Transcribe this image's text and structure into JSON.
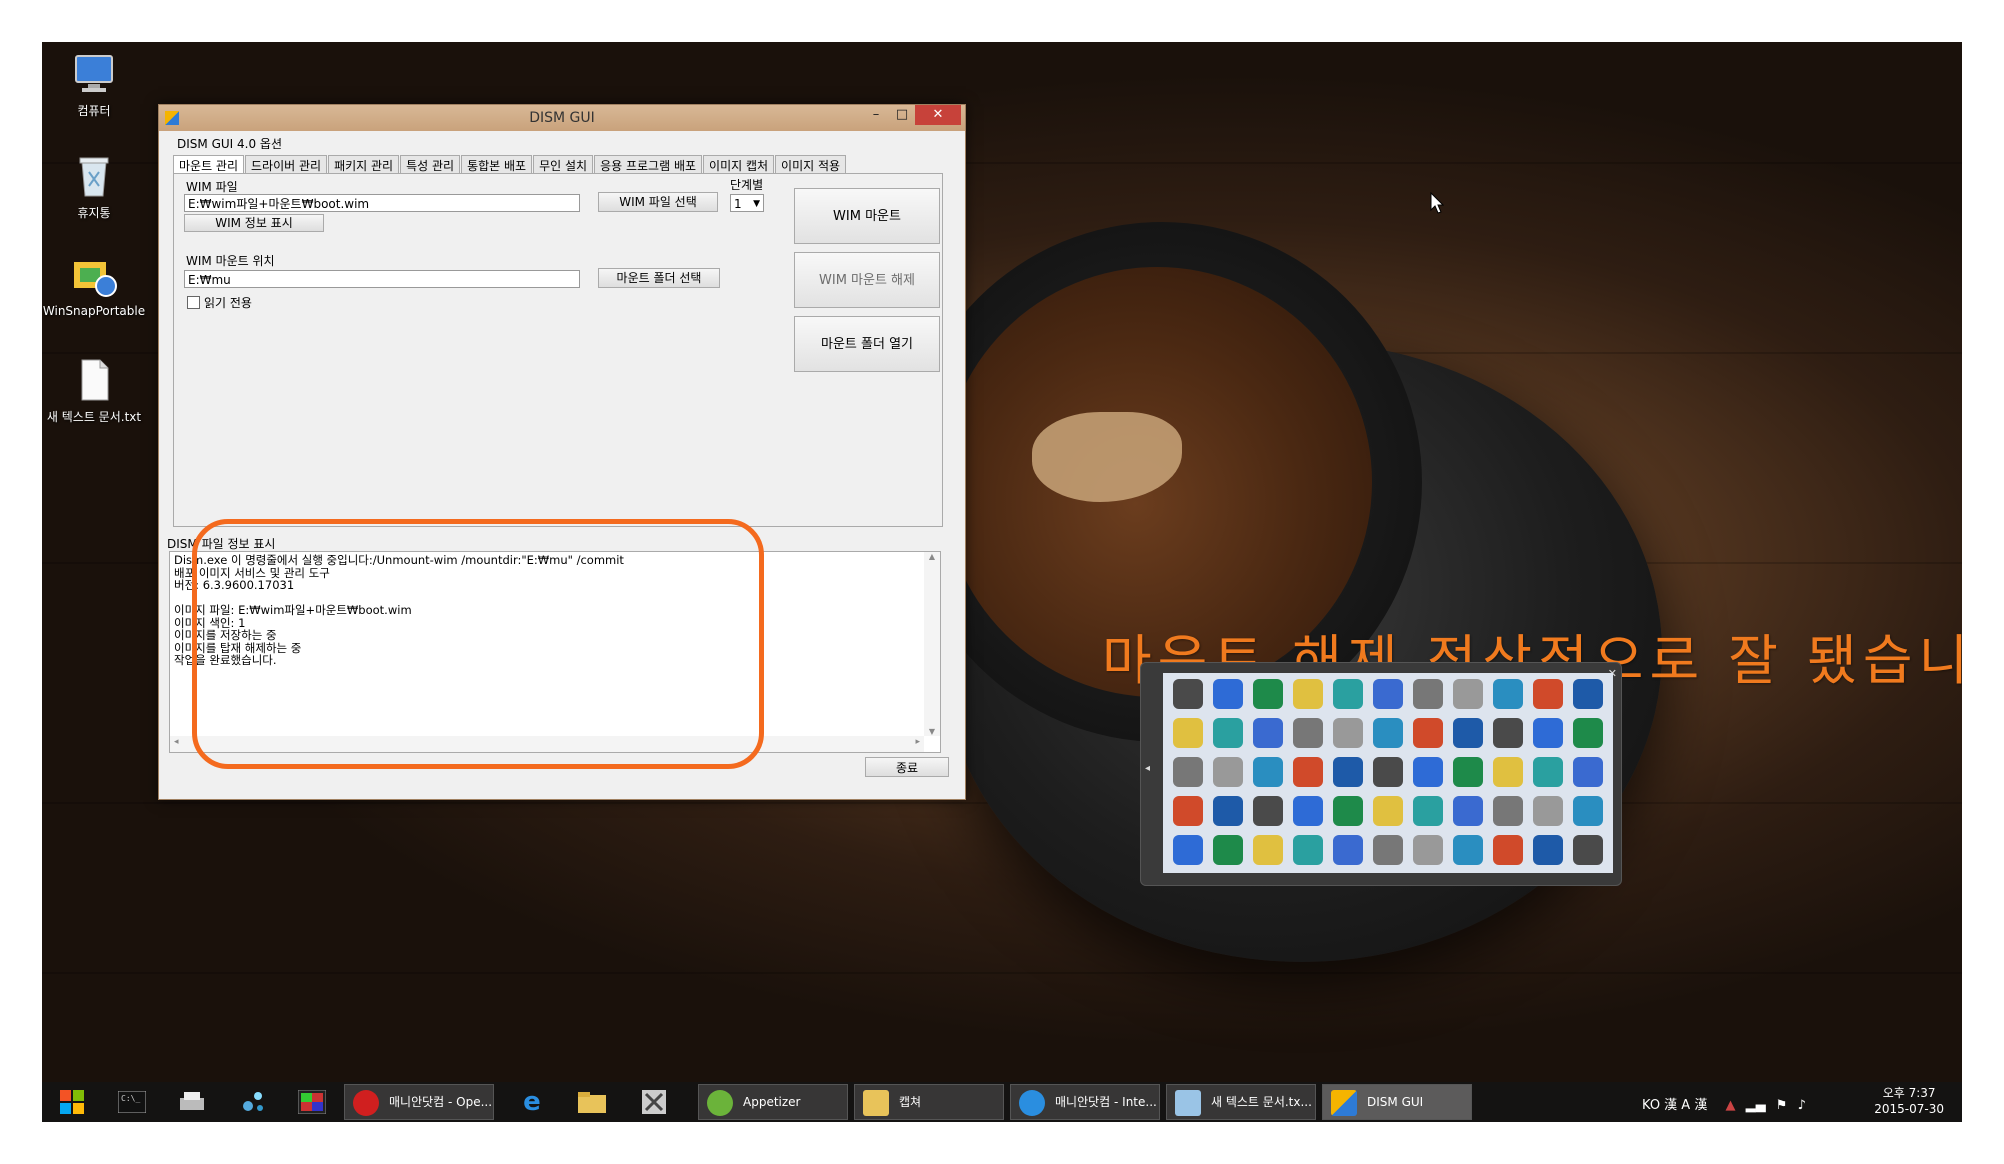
{
  "desktop": {
    "icons": [
      {
        "label": "컴퓨터",
        "icon": "computer-icon"
      },
      {
        "label": "휴지통",
        "icon": "recycle-bin-icon"
      },
      {
        "label": "WinSnapPortable",
        "icon": "winsnap-icon"
      },
      {
        "label": "새 텍스트 문서.txt",
        "icon": "text-file-icon"
      }
    ],
    "annotation": "마운트.해제 정상적으로 잘 됐습니다"
  },
  "window": {
    "title": "DISM GUI",
    "menu": "DISM GUI 4.0 옵션",
    "tabs": [
      "마운트 관리",
      "드라이버 관리",
      "패키지 관리",
      "특성 관리",
      "통합본 배포",
      "무인 설치",
      "응용 프로그램 배포",
      "이미지 캡처",
      "이미지 적용"
    ],
    "active_tab": "마운트 관리",
    "mount": {
      "wim_file_label": "WIM 파일",
      "wim_file_value": "E:₩wim파일+마운트₩boot.wim",
      "wim_info_button": "WIM 정보 표시",
      "select_wim_button": "WIM 파일 선택",
      "step_label": "단계별",
      "step_value": "1",
      "mount_location_label": "WIM 마운트 위치",
      "mount_location_value": "E:₩mu",
      "select_folder_button": "마운트 폴더 선택",
      "readonly_label": "읽기 전용",
      "readonly_checked": false,
      "mount_button": "WIM 마운트",
      "unmount_button": "WIM 마운트 해제",
      "open_folder_button": "마운트 폴더 열기"
    },
    "info_label": "DISM 파일 정보 표시",
    "output_lines": [
      "Dism.exe 이 명령줄에서 실행 중입니다:/Unmount-wim /mountdir:\"E:₩mu\" /commit",
      "배포 이미지 서비스 및 관리 도구",
      "버전: 6.3.9600.17031",
      "",
      "이미지 파일: E:₩wim파일+마운트₩boot.wim",
      "이미지 색인: 1",
      "이미지를 저장하는 중",
      "이미지를 탑재 해제하는 중",
      "작업을 완료했습니다."
    ],
    "exit_button": "종료"
  },
  "taskbar": {
    "buttons": [
      {
        "label": "매니안닷컴 - Ope...",
        "icon": "opera-icon",
        "color": "#d01f1f"
      },
      {
        "label": "Appetizer",
        "icon": "appetizer-icon",
        "color": "#6bb33a"
      },
      {
        "label": "캡쳐",
        "icon": "folder-icon",
        "color": "#e8c35a"
      },
      {
        "label": "매니안닷컴 - Inte...",
        "icon": "ie-icon",
        "color": "#2a8ee0"
      },
      {
        "label": "새 텍스트 문서.tx...",
        "icon": "notepad-icon",
        "color": "#9ac4e6"
      },
      {
        "label": "DISM GUI",
        "icon": "dism-icon",
        "color": "#f5b400"
      }
    ],
    "tray": "KO 漢 A 漢",
    "time": "오후 7:37",
    "date": "2015-07-30"
  },
  "colors": {
    "annotation": "#f07a1e",
    "title_bar": "#c9a27c",
    "close_button": "#c7423a"
  }
}
